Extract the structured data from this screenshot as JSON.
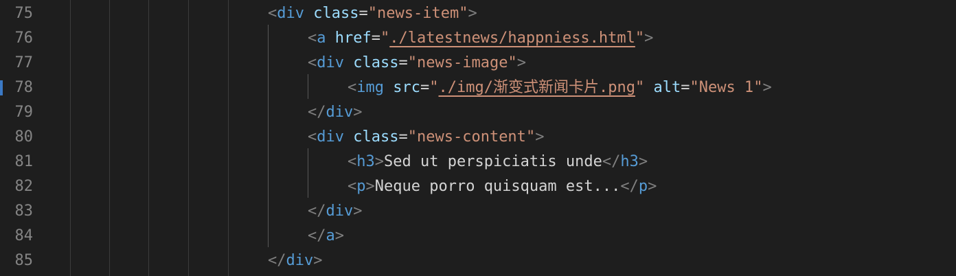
{
  "lines": [
    {
      "number": "75"
    },
    {
      "number": "76"
    },
    {
      "number": "77"
    },
    {
      "number": "78"
    },
    {
      "number": "79"
    },
    {
      "number": "80"
    },
    {
      "number": "81"
    },
    {
      "number": "82"
    },
    {
      "number": "83"
    },
    {
      "number": "84"
    },
    {
      "number": "85"
    }
  ],
  "code": {
    "l75": {
      "tag": "div",
      "attr": "class",
      "value": "news-item"
    },
    "l76": {
      "tag": "a",
      "attr": "href",
      "value": "./latestnews/happniess.html"
    },
    "l77": {
      "tag": "div",
      "attr": "class",
      "value": "news-image"
    },
    "l78": {
      "tag": "img",
      "attr1": "src",
      "value1": "./img/渐变式新闻卡片.png",
      "attr2": "alt",
      "value2": "News 1"
    },
    "l79": {
      "tag": "div"
    },
    "l80": {
      "tag": "div",
      "attr": "class",
      "value": "news-content"
    },
    "l81": {
      "tag": "h3",
      "text": "Sed ut perspiciatis unde"
    },
    "l82": {
      "tag": "p",
      "text": "Neque porro quisquam est..."
    },
    "l83": {
      "tag": "div"
    },
    "l84": {
      "tag": "a"
    },
    "l85": {
      "tag": "div"
    }
  },
  "syntax": {
    "open": "<",
    "close": ">",
    "end_open": "</",
    "eq": "=",
    "quote": "\""
  },
  "colors": {
    "background": "#1e1e1e",
    "line_number": "#858585",
    "tag": "#569cd6",
    "attribute": "#9cdcfe",
    "string": "#ce9178",
    "text": "#d4d4d4",
    "punctuation": "#808080",
    "git_marker": "#3b79c4"
  }
}
